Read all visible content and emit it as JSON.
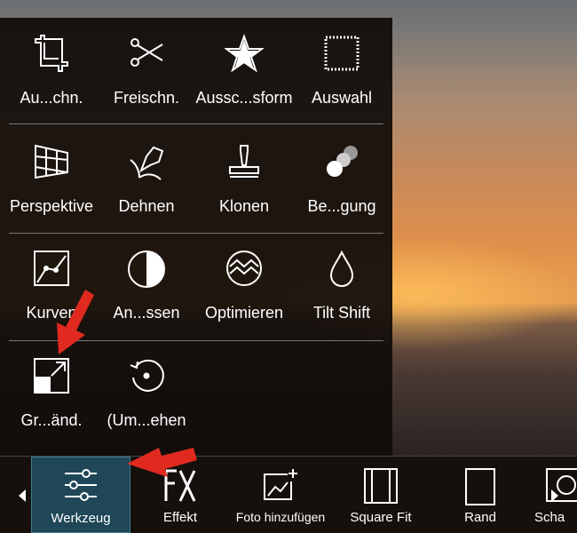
{
  "tools": [
    [
      {
        "label": "Au...chn.",
        "icon": "crop-icon"
      },
      {
        "label": "Freischn.",
        "icon": "scissors-icon"
      },
      {
        "label": "Aussc...sform",
        "icon": "star-icon"
      },
      {
        "label": "Auswahl",
        "icon": "selection-icon"
      }
    ],
    [
      {
        "label": "Perspektive",
        "icon": "perspective-icon"
      },
      {
        "label": "Dehnen",
        "icon": "stretch-icon"
      },
      {
        "label": "Klonen",
        "icon": "stamp-icon"
      },
      {
        "label": "Be...gung",
        "icon": "motion-icon"
      }
    ],
    [
      {
        "label": "Kurven",
        "icon": "curves-icon"
      },
      {
        "label": "An...ssen",
        "icon": "adjust-icon"
      },
      {
        "label": "Optimieren",
        "icon": "optimize-icon"
      },
      {
        "label": "Tilt Shift",
        "icon": "drop-icon"
      }
    ],
    [
      {
        "label": "Gr...änd.",
        "icon": "resize-icon"
      },
      {
        "label": "(Um...ehen",
        "icon": "rotate-icon"
      }
    ]
  ],
  "toolbar": [
    {
      "label": "Werkzeug",
      "icon": "sliders-icon",
      "selected": true
    },
    {
      "label": "Effekt",
      "icon": "fx-icon"
    },
    {
      "label": "Foto hinzufügen",
      "icon": "add-photo-icon"
    },
    {
      "label": "Square Fit",
      "icon": "square-fit-icon"
    },
    {
      "label": "Rand",
      "icon": "border-icon"
    },
    {
      "label": "Scha",
      "icon": "shadow-icon"
    }
  ],
  "colors": {
    "selected": "#1f4757",
    "arrow": "#e02a1f"
  }
}
